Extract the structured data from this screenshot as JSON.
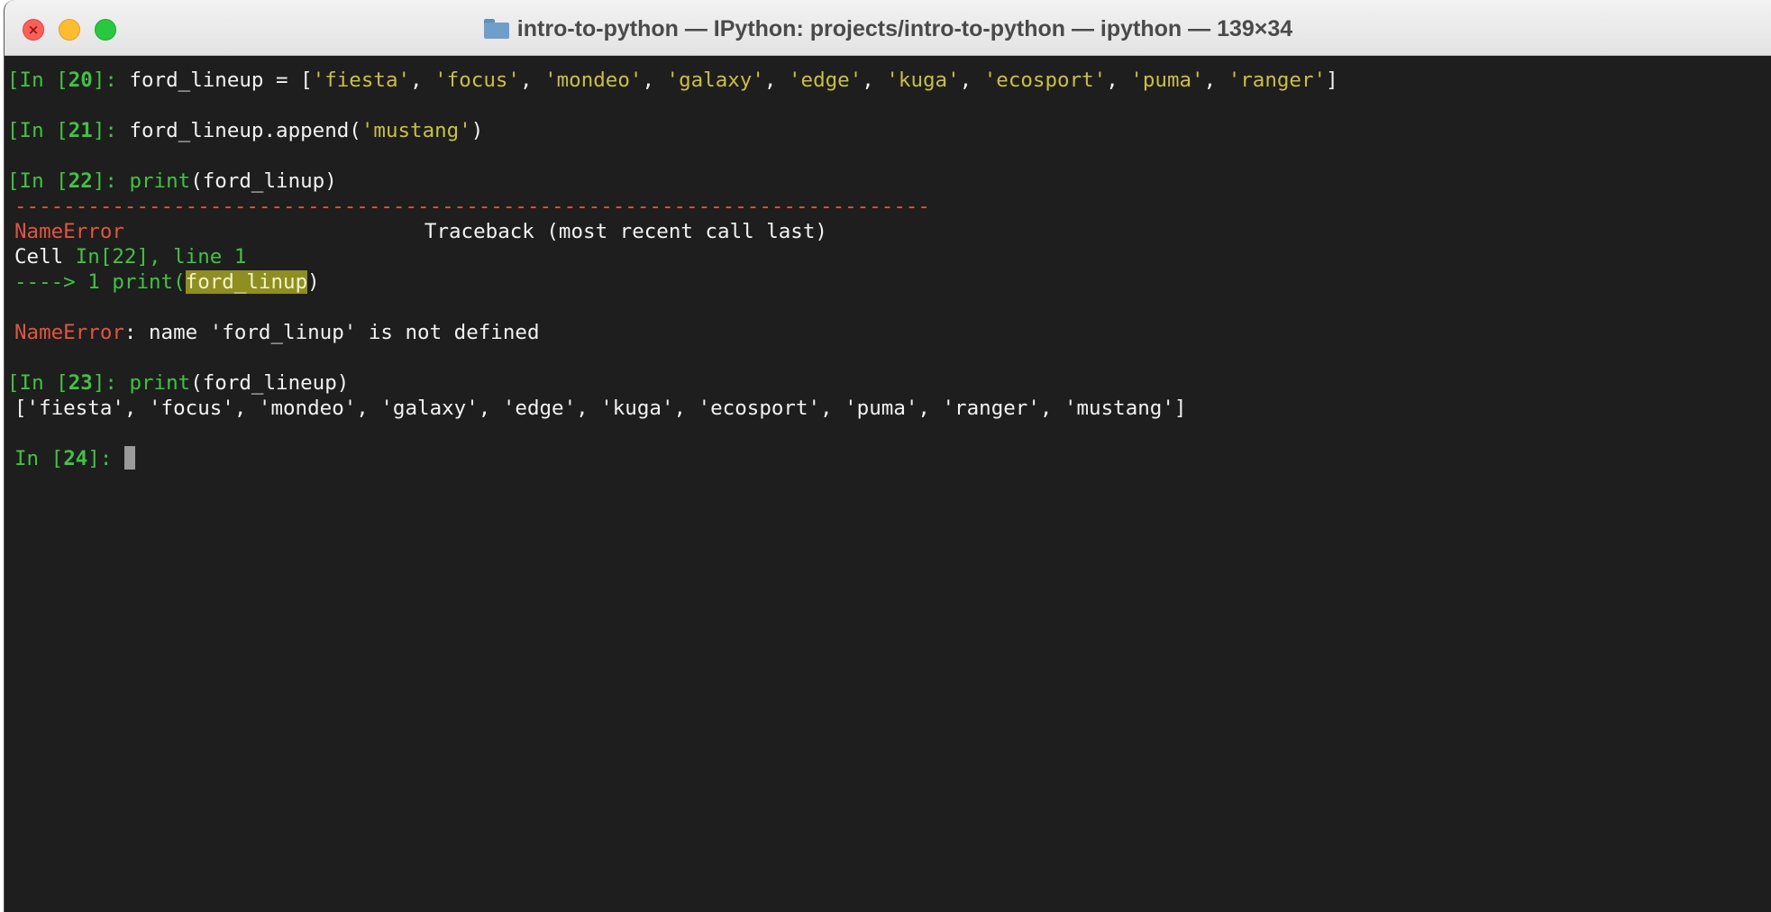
{
  "window": {
    "title": "intro-to-python — IPython: projects/intro-to-python — ipython — 139×34",
    "folder_icon": "folder-icon",
    "buttons": [
      "close",
      "minimize",
      "zoom"
    ]
  },
  "session": {
    "in20": {
      "prompt_open": "[In [",
      "num": "20",
      "prompt_close": "]: ",
      "code_prefix": "ford_lineup = [",
      "items": [
        "'fiesta'",
        "'focus'",
        "'mondeo'",
        "'galaxy'",
        "'edge'",
        "'kuga'",
        "'ecosport'",
        "'puma'",
        "'ranger'"
      ],
      "code_suffix": "]"
    },
    "in21": {
      "num": "21",
      "code_prefix": "ford_lineup.append(",
      "arg": "'mustang'",
      "code_suffix": ")"
    },
    "in22": {
      "num": "22",
      "fn": "print",
      "code": "(ford_linup)"
    },
    "traceback": {
      "dashes": "---------------------------------------------------------------------------",
      "error_name": "NameError",
      "header_right": "Traceback (most recent call last)",
      "cell_label": "Cell ",
      "cell_ref": "In[22], line 1",
      "arrow": "----> 1 ",
      "arrow_code_prefix": "print(",
      "arrow_highlight": "ford_linup",
      "arrow_code_suffix": ")",
      "message_name": "NameError",
      "message": ": name 'ford_linup' is not defined"
    },
    "in23": {
      "num": "23",
      "fn": "print",
      "code": "(ford_lineup)",
      "output": "['fiesta', 'focus', 'mondeo', 'galaxy', 'edge', 'kuga', 'ecosport', 'puma', 'ranger', 'mustang']"
    },
    "in24": {
      "prompt_open": "In [",
      "num": "24",
      "prompt_close": "]: "
    }
  },
  "colors": {
    "background": "#1e1e1e",
    "prompt": "#3fc43f",
    "string": "#c9c13e",
    "error": "#e0553f",
    "text": "#f2f2f2"
  }
}
